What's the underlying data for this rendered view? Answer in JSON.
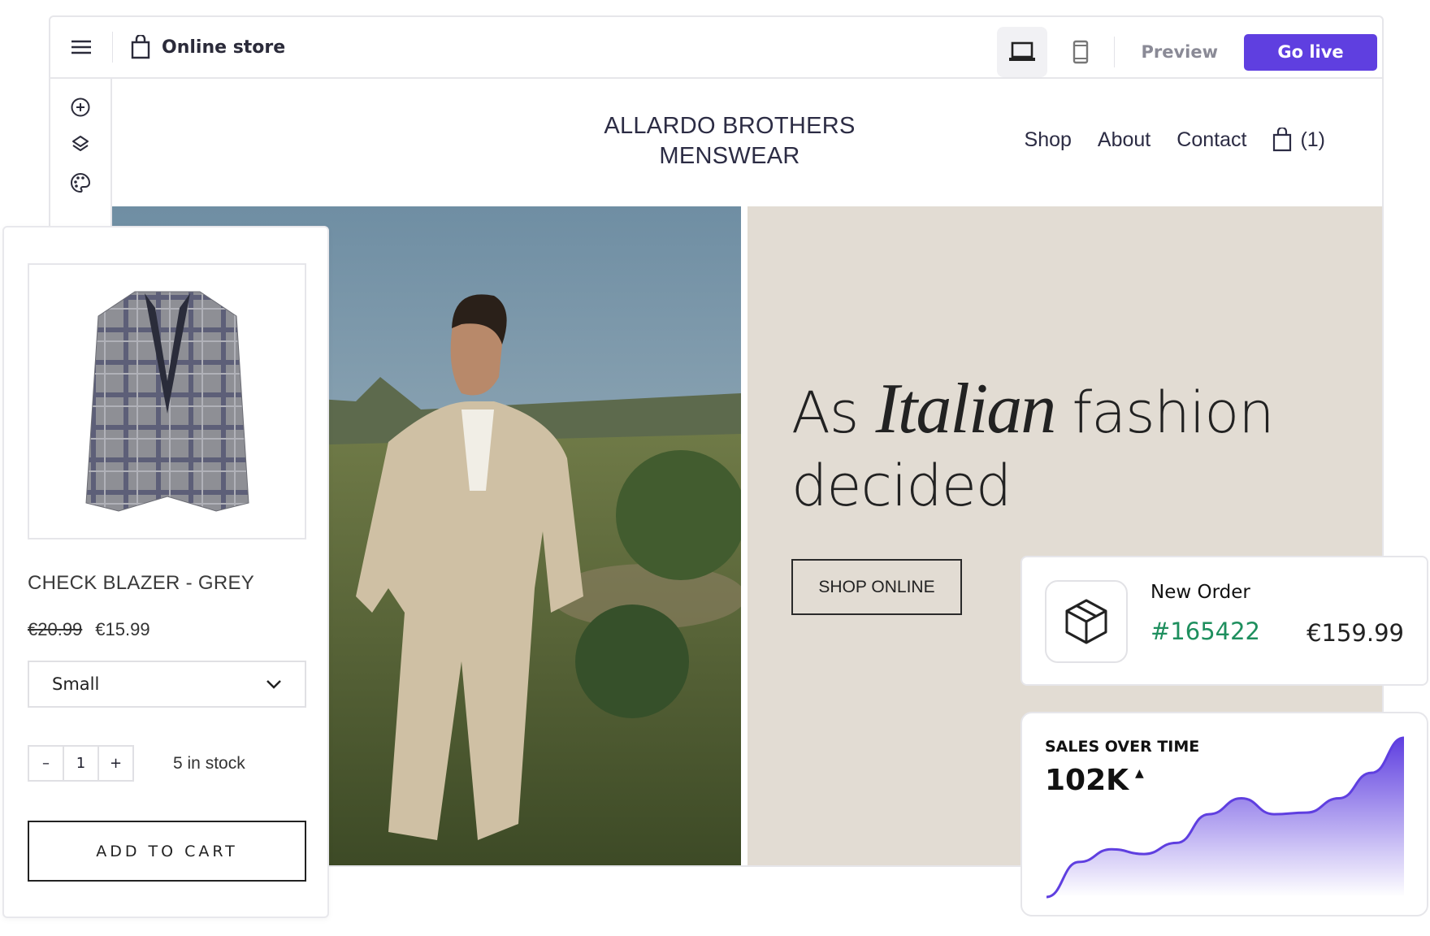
{
  "topbar": {
    "title": "Online store",
    "preview_label": "Preview",
    "golive_label": "Go live",
    "accent": "#5f3fe0"
  },
  "rail": {
    "icons": [
      "add-section-icon",
      "layers-icon",
      "theme-palette-icon"
    ]
  },
  "store": {
    "brand_line1": "ALLARDO BROTHERS",
    "brand_line2": "MENSWEAR",
    "nav": [
      "Shop",
      "About",
      "Contact"
    ],
    "cart_count": "(1)"
  },
  "hero": {
    "head_pre": "As",
    "head_italic": "Italian",
    "head_post": "fashion",
    "head_line2": "decided",
    "cta": "SHOP ONLINE",
    "bg": "#e2dcd3"
  },
  "product": {
    "title": "CHECK BLAZER - GREY",
    "old_price": "€20.99",
    "price": "€15.99",
    "size": "Small",
    "qty_minus": "–",
    "qty": "1",
    "qty_plus": "+",
    "stock": "5 in stock",
    "add_to_cart": "ADD TO CART"
  },
  "order": {
    "title": "New Order",
    "number": "#165422",
    "amount": "€159.99",
    "number_color": "#1e8f5e"
  },
  "sales": {
    "title": "SALES OVER TIME",
    "value": "102K",
    "trend": "▲"
  },
  "chart_data": {
    "type": "area",
    "title": "SALES OVER TIME",
    "trend": "up",
    "values": [
      0,
      22,
      30,
      27,
      34,
      52,
      62,
      52,
      53,
      62,
      78,
      100
    ],
    "color": "#5f3fe0",
    "axes": false,
    "grid": false
  }
}
